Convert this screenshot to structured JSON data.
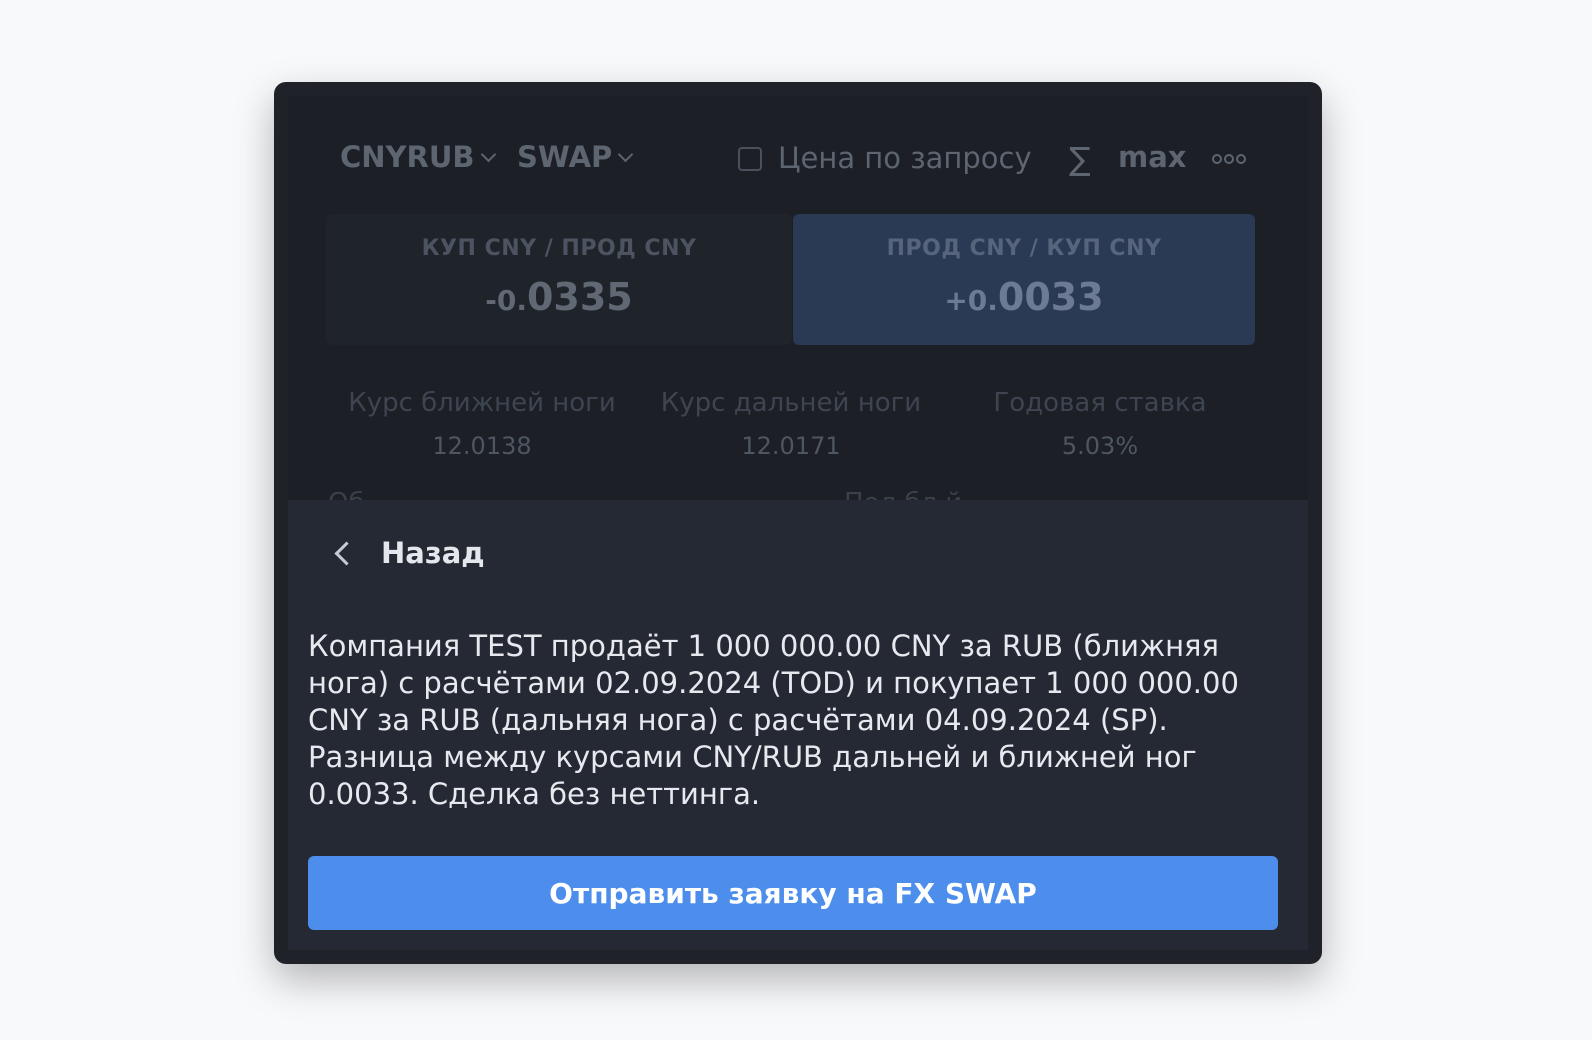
{
  "header": {
    "pair": "CNYRUB",
    "product": "SWAP",
    "rfq_label": "Цена по запросу",
    "sigma": "∑",
    "max_label": "max"
  },
  "quotes": {
    "buy": {
      "label": "КУП CNY / ПРОД CNY",
      "prefix": "-0.",
      "main": "0335"
    },
    "sell": {
      "label": "ПРОД CNY / КУП CNY",
      "prefix": "+0.",
      "main": "0033"
    }
  },
  "info": [
    {
      "label": "Курс ближней ноги",
      "value": "12.0138"
    },
    {
      "label": "Курс дальней ноги",
      "value": "12.0171"
    },
    {
      "label": "Годовая ставка",
      "value": "5.03%"
    }
  ],
  "peek": {
    "left": "Об",
    "right": "Пол      бл   й"
  },
  "confirm": {
    "back_label": "Назад",
    "description": "Компания TEST продаёт 1 000 000.00 CNY за RUB (ближняя нога) с расчётами 02.09.2024 (TOD) и покупает 1 000 000.00 CNY за RUB (дальняя нога) с расчётами 04.09.2024 (SP). Разница между курсами CNY/RUB дальней и ближней ног 0.0033. Сделка без неттинга.",
    "submit_label": "Отправить заявку на FX SWAP"
  },
  "colors": {
    "accent": "#4d8eec",
    "panel": "#252933",
    "sell_highlight": "#2a3a55"
  }
}
